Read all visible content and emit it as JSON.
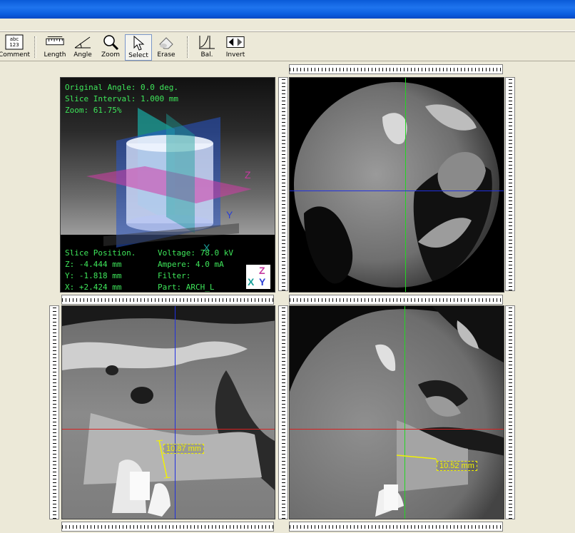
{
  "toolbar": {
    "buttons": [
      {
        "label": "Comment",
        "icon": "comment-icon"
      },
      {
        "label": "Length",
        "icon": "ruler-icon"
      },
      {
        "label": "Angle",
        "icon": "angle-icon"
      },
      {
        "label": "Zoom",
        "icon": "magnifier-icon"
      },
      {
        "label": "Select",
        "icon": "arrow-cursor-icon"
      },
      {
        "label": "Erase",
        "icon": "eraser-icon"
      },
      {
        "label": "Bal.",
        "icon": "balance-icon"
      },
      {
        "label": "Invert",
        "icon": "invert-icon"
      }
    ],
    "comment_icon_text": "abc 123"
  },
  "info": {
    "original_angle": "Original Angle: 0.0 deg.",
    "slice_interval": "Slice Interval: 1.000 mm",
    "zoom": "Zoom: 61.75%",
    "slice_position": "Slice Position.",
    "z": "Z: -4.444 mm",
    "y": "Y: -1.818 mm",
    "x": "X: +2.424 mm",
    "voltage": "Voltage: 78.0 kV",
    "ampere": "Ampere: 4.0 mA",
    "filter": "Filter:",
    "part": "Part: ARCH_L",
    "axis_z": "Z",
    "axis_y": "Y",
    "axis_x": "X"
  },
  "measurements": {
    "sagittal": "10.87 mm",
    "coronal": "10.52 mm"
  },
  "colors": {
    "crosshair_green": "#22d622",
    "crosshair_blue": "#2030e0",
    "crosshair_red": "#d82020",
    "measurement": "#f2f200",
    "overlay_text": "#3ee65a"
  }
}
